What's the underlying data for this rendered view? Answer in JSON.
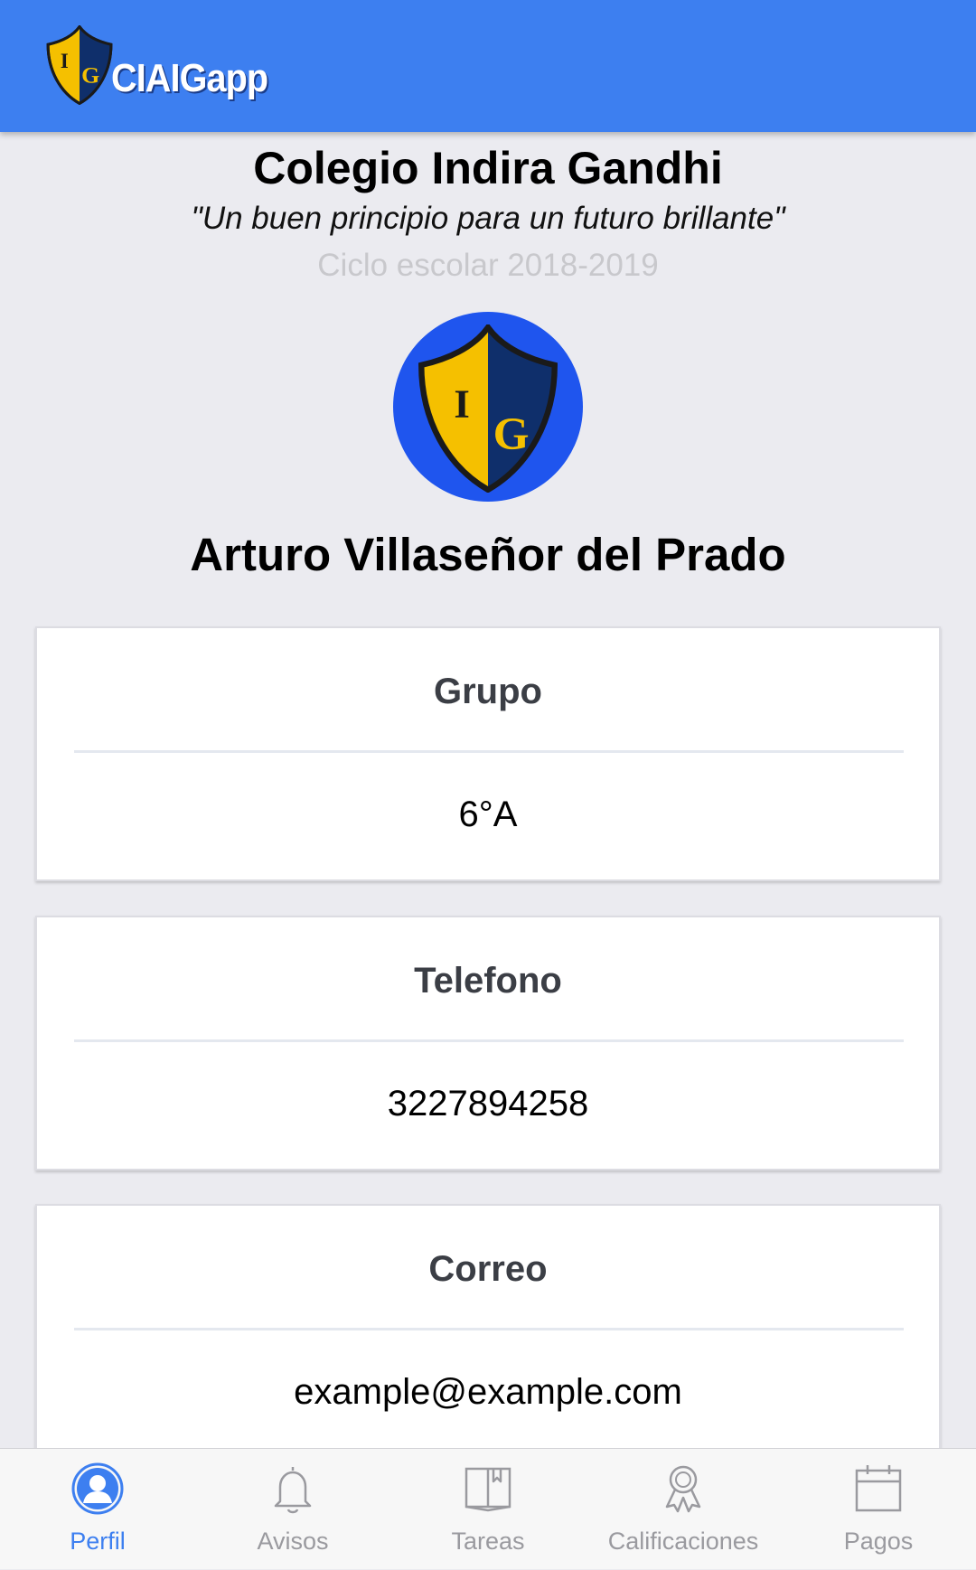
{
  "header": {
    "app_name": "CIAIGapp",
    "logo_letters": [
      "I",
      "G"
    ]
  },
  "school": {
    "name": "Colegio Indira Gandhi",
    "motto": "\"Un buen principio para un futuro brillante\"",
    "cycle": "Ciclo escolar 2018-2019"
  },
  "student": {
    "name": "Arturo Villaseñor del Prado"
  },
  "cards": [
    {
      "label": "Grupo",
      "value": "6°A"
    },
    {
      "label": "Telefono",
      "value": "3227894258"
    },
    {
      "label": "Correo",
      "value": "example@example.com"
    }
  ],
  "tabs": [
    {
      "label": "Perfil",
      "icon": "person-icon",
      "active": true
    },
    {
      "label": "Avisos",
      "icon": "bell-icon",
      "active": false
    },
    {
      "label": "Tareas",
      "icon": "book-icon",
      "active": false
    },
    {
      "label": "Calificaciones",
      "icon": "award-icon",
      "active": false
    },
    {
      "label": "Pagos",
      "icon": "calendar-icon",
      "active": false
    }
  ],
  "colors": {
    "accent": "#3d7ff0",
    "avatar_bg": "#1f55ee",
    "shield_gold": "#f5c000",
    "shield_navy": "#0f2f6b",
    "inactive_tab": "#9a9a9f"
  }
}
